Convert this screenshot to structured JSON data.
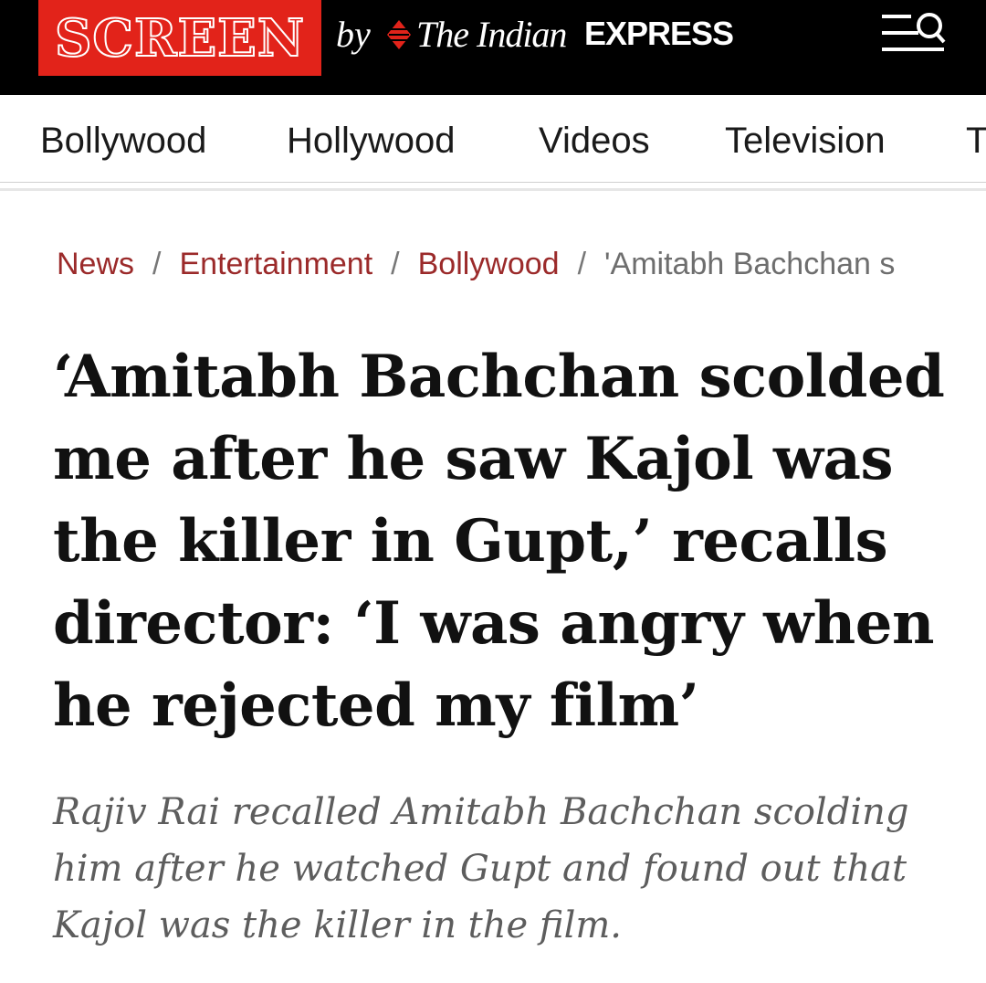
{
  "header": {
    "logo": "SCREEN",
    "by": "by",
    "publisher_name": "The Indian",
    "publisher_express": "EXPRESS",
    "menu_icon": "menu-search-icon"
  },
  "nav": {
    "items": [
      "Bollywood",
      "Hollywood",
      "Videos",
      "Television",
      "T"
    ]
  },
  "breadcrumb": {
    "items": [
      "News",
      "Entertainment",
      "Bollywood"
    ],
    "separator": "/",
    "current": "'Amitabh Bachchan s"
  },
  "article": {
    "headline": "‘Amitabh Bachchan scolded me after he saw Kajol was the killer in Gupt,’ recalls director: ‘I was angry when he rejected my film’",
    "summary": "Rajiv Rai recalled Amitabh Bachchan scolding him after he watched Gupt and found out that Kajol was the killer in the film."
  },
  "colors": {
    "brand_red": "#e2231a",
    "topbar": "#000000",
    "breadcrumb_link": "#9b2a2a"
  }
}
